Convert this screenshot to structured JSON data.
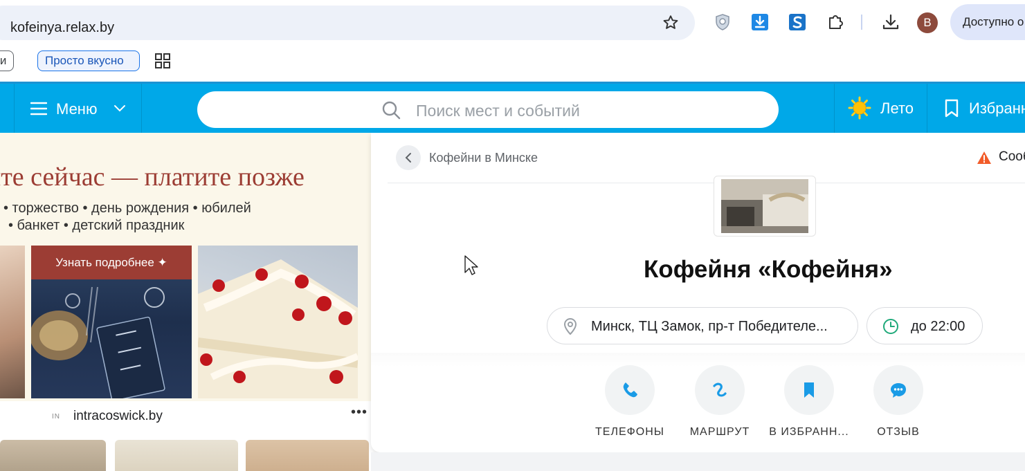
{
  "browser": {
    "url": "kofeinya.relax.by",
    "avatar_letter": "B",
    "available_button": "Доступно о",
    "bookmarks": [
      "йни",
      "Просто вкусно"
    ]
  },
  "site_header": {
    "menu_label": "Меню",
    "search_placeholder": "Поиск мест и событий",
    "summer_label": "Лето",
    "favorites_label": "Избранн"
  },
  "ad": {
    "title": "айте сейчас — платите позже",
    "line1": "• торжество • день рождения • юбилей",
    "line2": "• банкет • детский праздник",
    "button_label": "Узнать подробнее ✦",
    "domain_icon": "IN",
    "domain": "intracoswick.by",
    "more": "•••"
  },
  "place": {
    "breadcrumb": "Кофейни в Минске",
    "report_label": "Сооб",
    "name": "Кофейня «Кофейня»",
    "address": "Минск, ТЦ Замок, пр-т Победителе...",
    "hours": "до 22:00",
    "actions": [
      {
        "label": "ТЕЛЕФОНЫ",
        "icon": "phone-icon"
      },
      {
        "label": "МАРШРУТ",
        "icon": "route-icon"
      },
      {
        "label": "В ИЗБРАНН...",
        "icon": "bookmark-icon"
      },
      {
        "label": "ОТЗЫВ",
        "icon": "chat-icon"
      }
    ]
  },
  "colors": {
    "brand_blue": "#00a8e8",
    "action_blue": "#1a9be6",
    "ad_red": "#9c3d34",
    "hours_green": "#1fa97a",
    "warning": "#f25c2a"
  }
}
